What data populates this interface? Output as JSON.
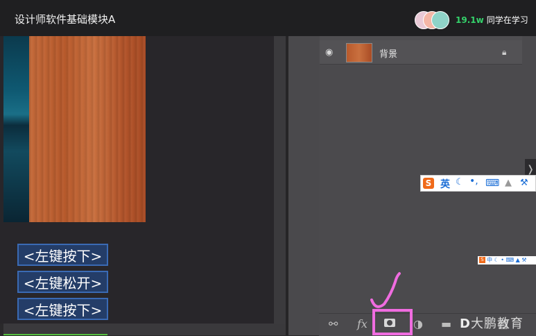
{
  "header": {
    "title": "设计师软件基础模块A",
    "learner_count": "19.1w",
    "learner_label": "同学在学习"
  },
  "canvas": {
    "key_events": [
      "<左键按下>",
      "<左键松开>",
      "<左键按下>"
    ]
  },
  "layers_panel": {
    "layer_name": "背景",
    "bottom_icons": [
      "link-icon",
      "fx-icon",
      "mask-icon",
      "adjustment-icon",
      "folder-icon",
      "new-layer-icon",
      "trash-icon"
    ],
    "fx_label": "fx"
  },
  "ime": {
    "logo": "S",
    "mode": "英",
    "small_mode": "中"
  },
  "watermark": {
    "letter": "D",
    "text": "大鹏教育"
  },
  "colors": {
    "annotation": "#f06ce0",
    "learner_count": "#34d36b",
    "key_event_bg": "#243d68"
  }
}
